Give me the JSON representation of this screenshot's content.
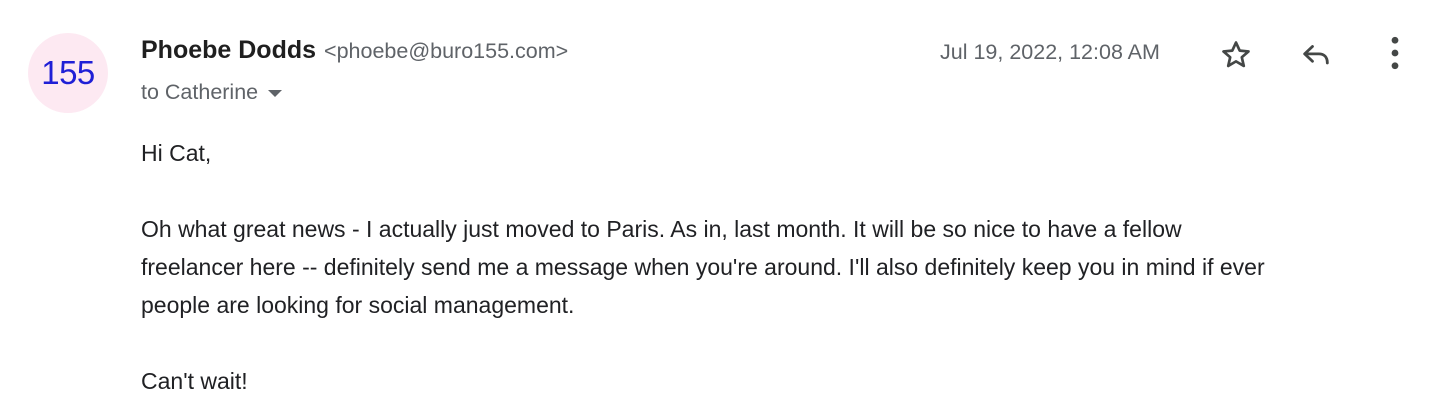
{
  "sender": {
    "avatar_text": "155",
    "name": "Phoebe Dodds",
    "email": "<phoebe@buro155.com>"
  },
  "recipient": {
    "label": "to Catherine"
  },
  "meta": {
    "timestamp": "Jul 19, 2022, 12:08 AM"
  },
  "actions": {
    "star_icon": "star-outline-icon",
    "reply_icon": "reply-arrow-icon",
    "more_icon": "vertical-dots-icon"
  },
  "body": {
    "greeting": "Hi Cat,",
    "paragraph_line_1": "Oh what great news - I actually just moved to Paris. As in, last month. It will be so nice to have a fellow",
    "paragraph_line_2": "freelancer here -- definitely send me a message when you're around. I'll also definitely keep you in mind if ever",
    "paragraph_line_3": "people are looking for social management.",
    "closing": "Can't wait!"
  },
  "colors": {
    "avatar_bg": "#fde9f2",
    "avatar_text": "#1f1fd6",
    "secondary_text": "#5f6368",
    "icon": "#444746"
  }
}
